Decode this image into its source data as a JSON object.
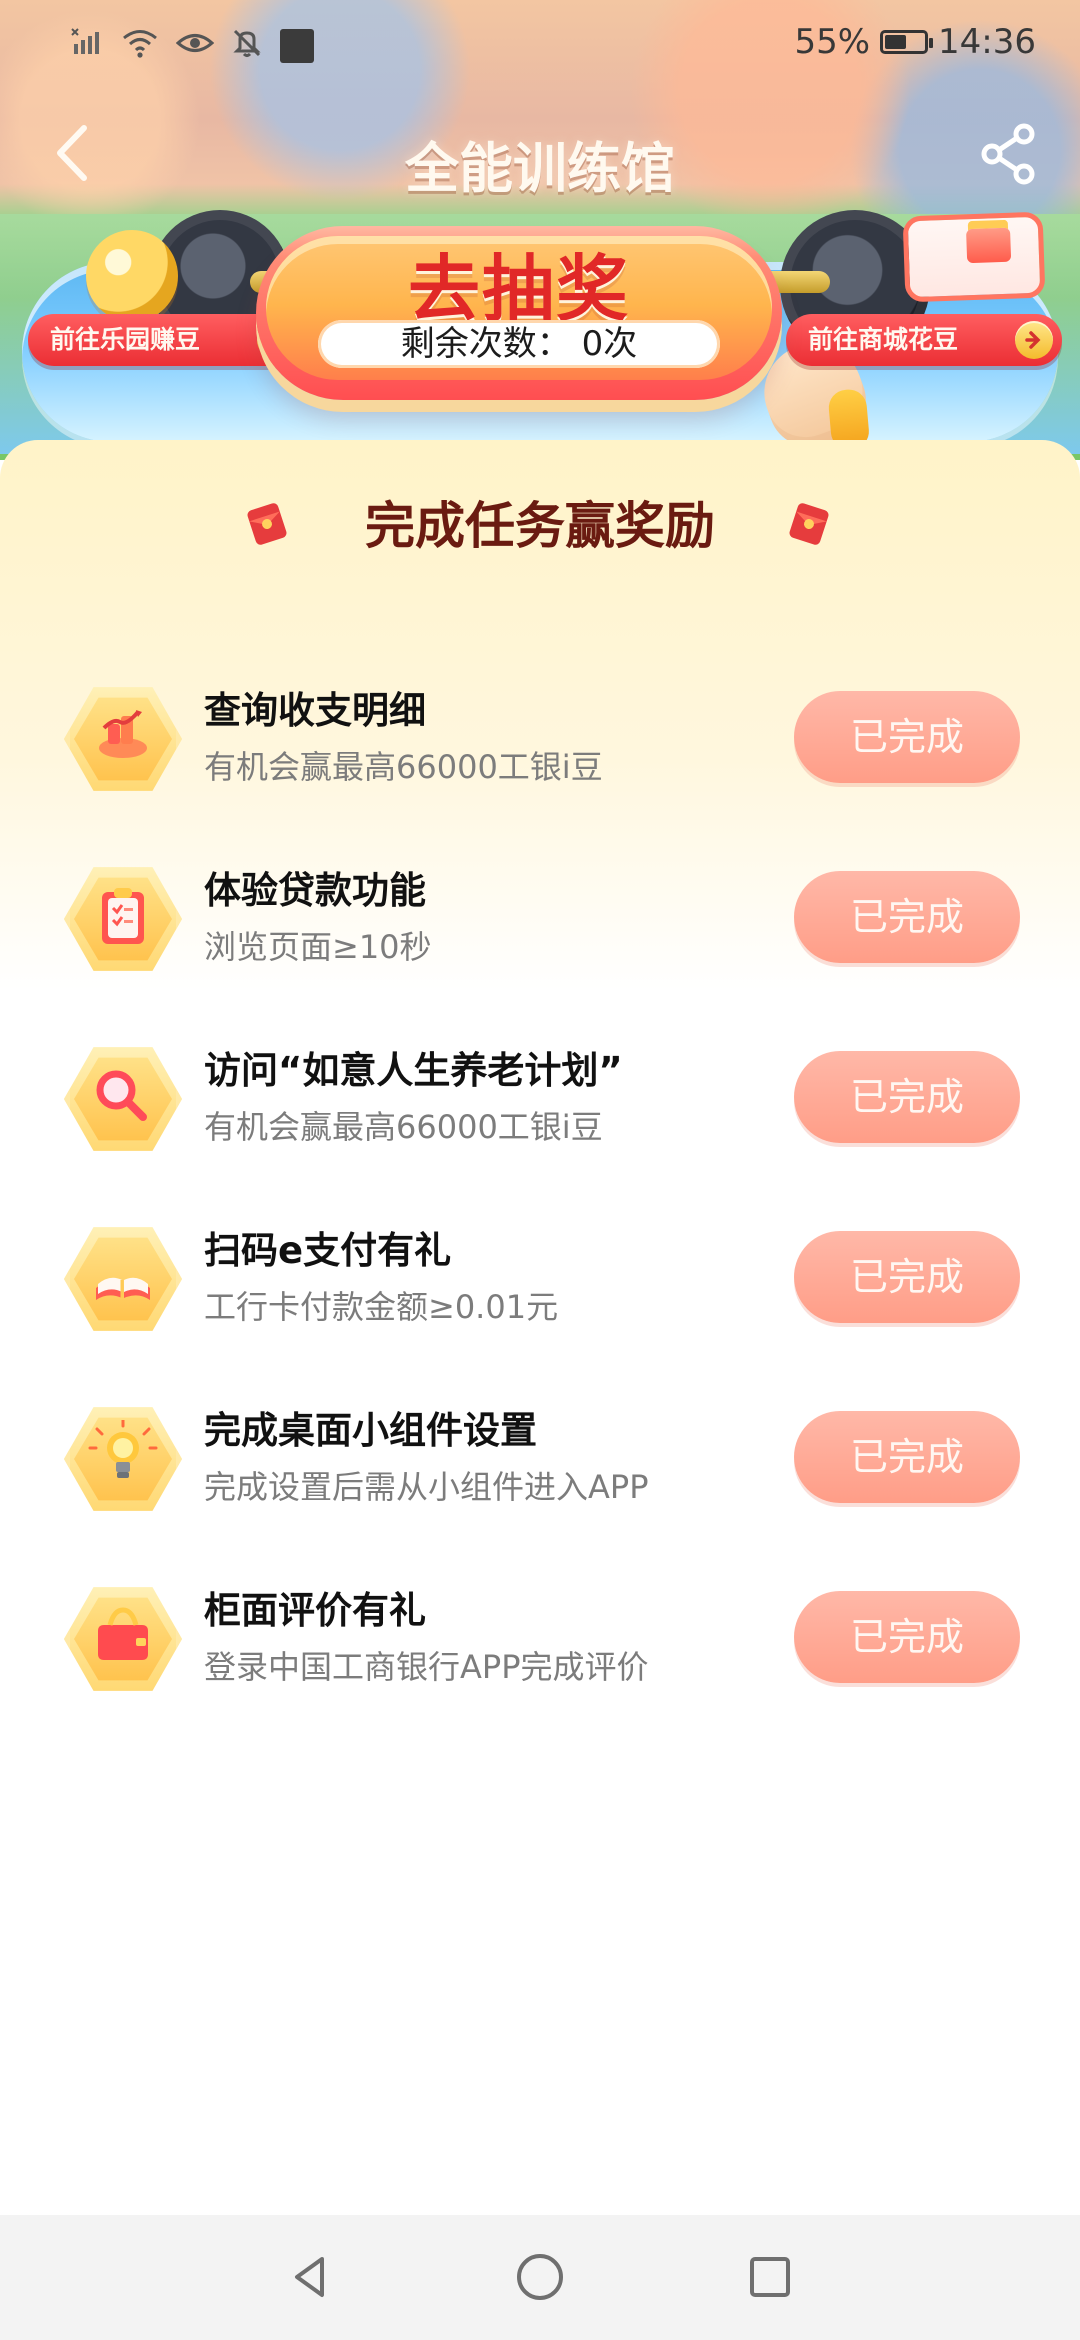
{
  "status_bar": {
    "battery_percent": "55%",
    "battery_level": 0.55,
    "time": "14:36",
    "icons": [
      "signal-icon",
      "wifi-icon",
      "eye-icon",
      "mute-icon",
      "notification-square-icon"
    ]
  },
  "header": {
    "title": "全能训练馆"
  },
  "banner": {
    "left_link": "前往乐园赚豆",
    "right_link": "前往商城花豆",
    "lottery_title": "去抽奖",
    "remaining_label": "剩余次数：",
    "remaining_value": "0次"
  },
  "section": {
    "title": "完成任务赢奖励"
  },
  "tasks": [
    {
      "title": "查询收支明细",
      "description": "有机会赢最高66000工银i豆",
      "button": "已完成",
      "icon": "receipt-chart-icon"
    },
    {
      "title": "体验贷款功能",
      "description": "浏览页面≥10秒",
      "button": "已完成",
      "icon": "clipboard-icon"
    },
    {
      "title": "访问“如意人生养老计划”",
      "description": "有机会赢最高66000工银i豆",
      "button": "已完成",
      "icon": "magnifier-icon"
    },
    {
      "title": "扫码e支付有礼",
      "description": "工行卡付款金额≥0.01元",
      "button": "已完成",
      "icon": "book-icon"
    },
    {
      "title": "完成桌面小组件设置",
      "description": "完成设置后需从小组件进入APP",
      "button": "已完成",
      "icon": "lightbulb-icon"
    },
    {
      "title": "柜面评价有礼",
      "description": "登录中国工商银行APP完成评价",
      "button": "已完成",
      "icon": "purse-icon"
    }
  ],
  "colors": {
    "accent_red": "#e12827",
    "button_peach": "#ffa996",
    "heading_brown": "#6a1b11"
  }
}
